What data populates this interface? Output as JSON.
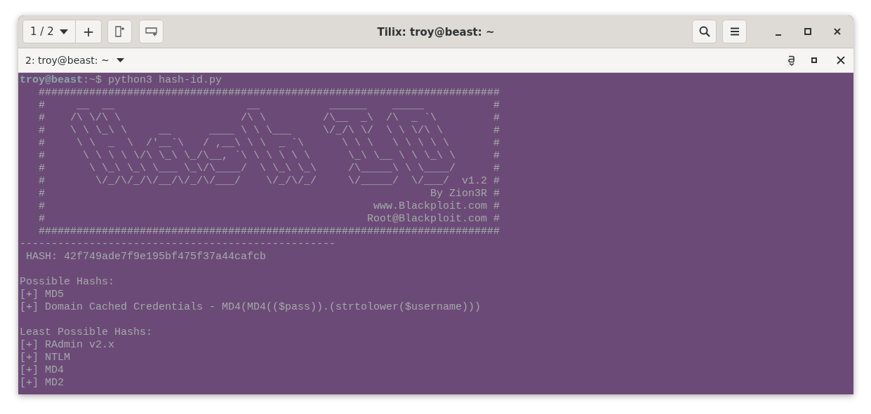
{
  "window": {
    "title": "Tilix: troy@beast: ~"
  },
  "header": {
    "session_counter": "1 / 2",
    "add_label": "+"
  },
  "session_tab": {
    "title": "2: troy@beast: ~"
  },
  "terminal": {
    "prompt": {
      "user_host": "troy@beast",
      "command": ":~$ python3 hash-id.py"
    },
    "banner": [
      "   #########################################################################",
      "   #     __  __                     __           ______    _____           #",
      "   #    /\\ \\/\\ \\                   /\\ \\         /\\__  _\\  /\\  _ `\\         #",
      "   #    \\ \\ \\_\\ \\     __      ____ \\ \\ \\___     \\/_/\\ \\/  \\ \\ \\/\\ \\        #",
      "   #     \\ \\  _  \\  /'__`\\   / ,__\\ \\ \\  _ `\\      \\ \\ \\   \\ \\ \\ \\ \\       #",
      "   #      \\ \\ \\ \\ \\/\\ \\_\\ \\_/\\__, `\\ \\ \\ \\ \\ \\      \\_\\ \\__ \\ \\ \\_\\ \\      #",
      "   #       \\ \\_\\ \\_\\ \\___ \\_\\/\\____/  \\ \\_\\ \\_\\     /\\_____\\ \\ \\____/      #",
      "   #        \\/_/\\/_/\\/__/\\/_/\\/___/    \\/_/\\/_/     \\/_____/  \\/___/  v1.2 #",
      "   #                                                             By Zion3R #",
      "   #                                                    www.Blackploit.com #",
      "   #                                                   Root@Blackploit.com #",
      "   #########################################################################"
    ],
    "separator": "--------------------------------------------------",
    "hash_line": " HASH: 42f749ade7f9e195bf475f37a44cafcb",
    "sections": [
      {
        "heading": "Possible Hashs:",
        "items": [
          "[+] MD5",
          "[+] Domain Cached Credentials - MD4(MD4(($pass)).(strtolower($username)))"
        ]
      },
      {
        "heading": "Least Possible Hashs:",
        "items": [
          "[+] RAdmin v2.x",
          "[+] NTLM",
          "[+] MD4",
          "[+] MD2"
        ]
      }
    ]
  }
}
